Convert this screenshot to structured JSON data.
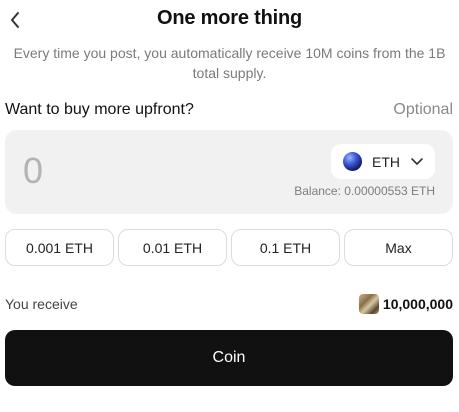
{
  "header": {
    "title": "One more thing",
    "back_icon": "chevron-left-icon"
  },
  "subtitle": "Every time you post, you automatically receive 10M coins from the 1B total supply.",
  "buy_section": {
    "label": "Want to buy more upfront?",
    "optional_label": "Optional"
  },
  "amount": {
    "placeholder": "0",
    "value": "",
    "token": "ETH",
    "token_icon": "eth-icon",
    "balance": "Balance: 0.00000553 ETH"
  },
  "presets": [
    "0.001 ETH",
    "0.01 ETH",
    "0.1 ETH",
    "Max"
  ],
  "receive": {
    "label": "You receive",
    "amount": "10,000,000"
  },
  "submit": {
    "label": "Coin"
  }
}
